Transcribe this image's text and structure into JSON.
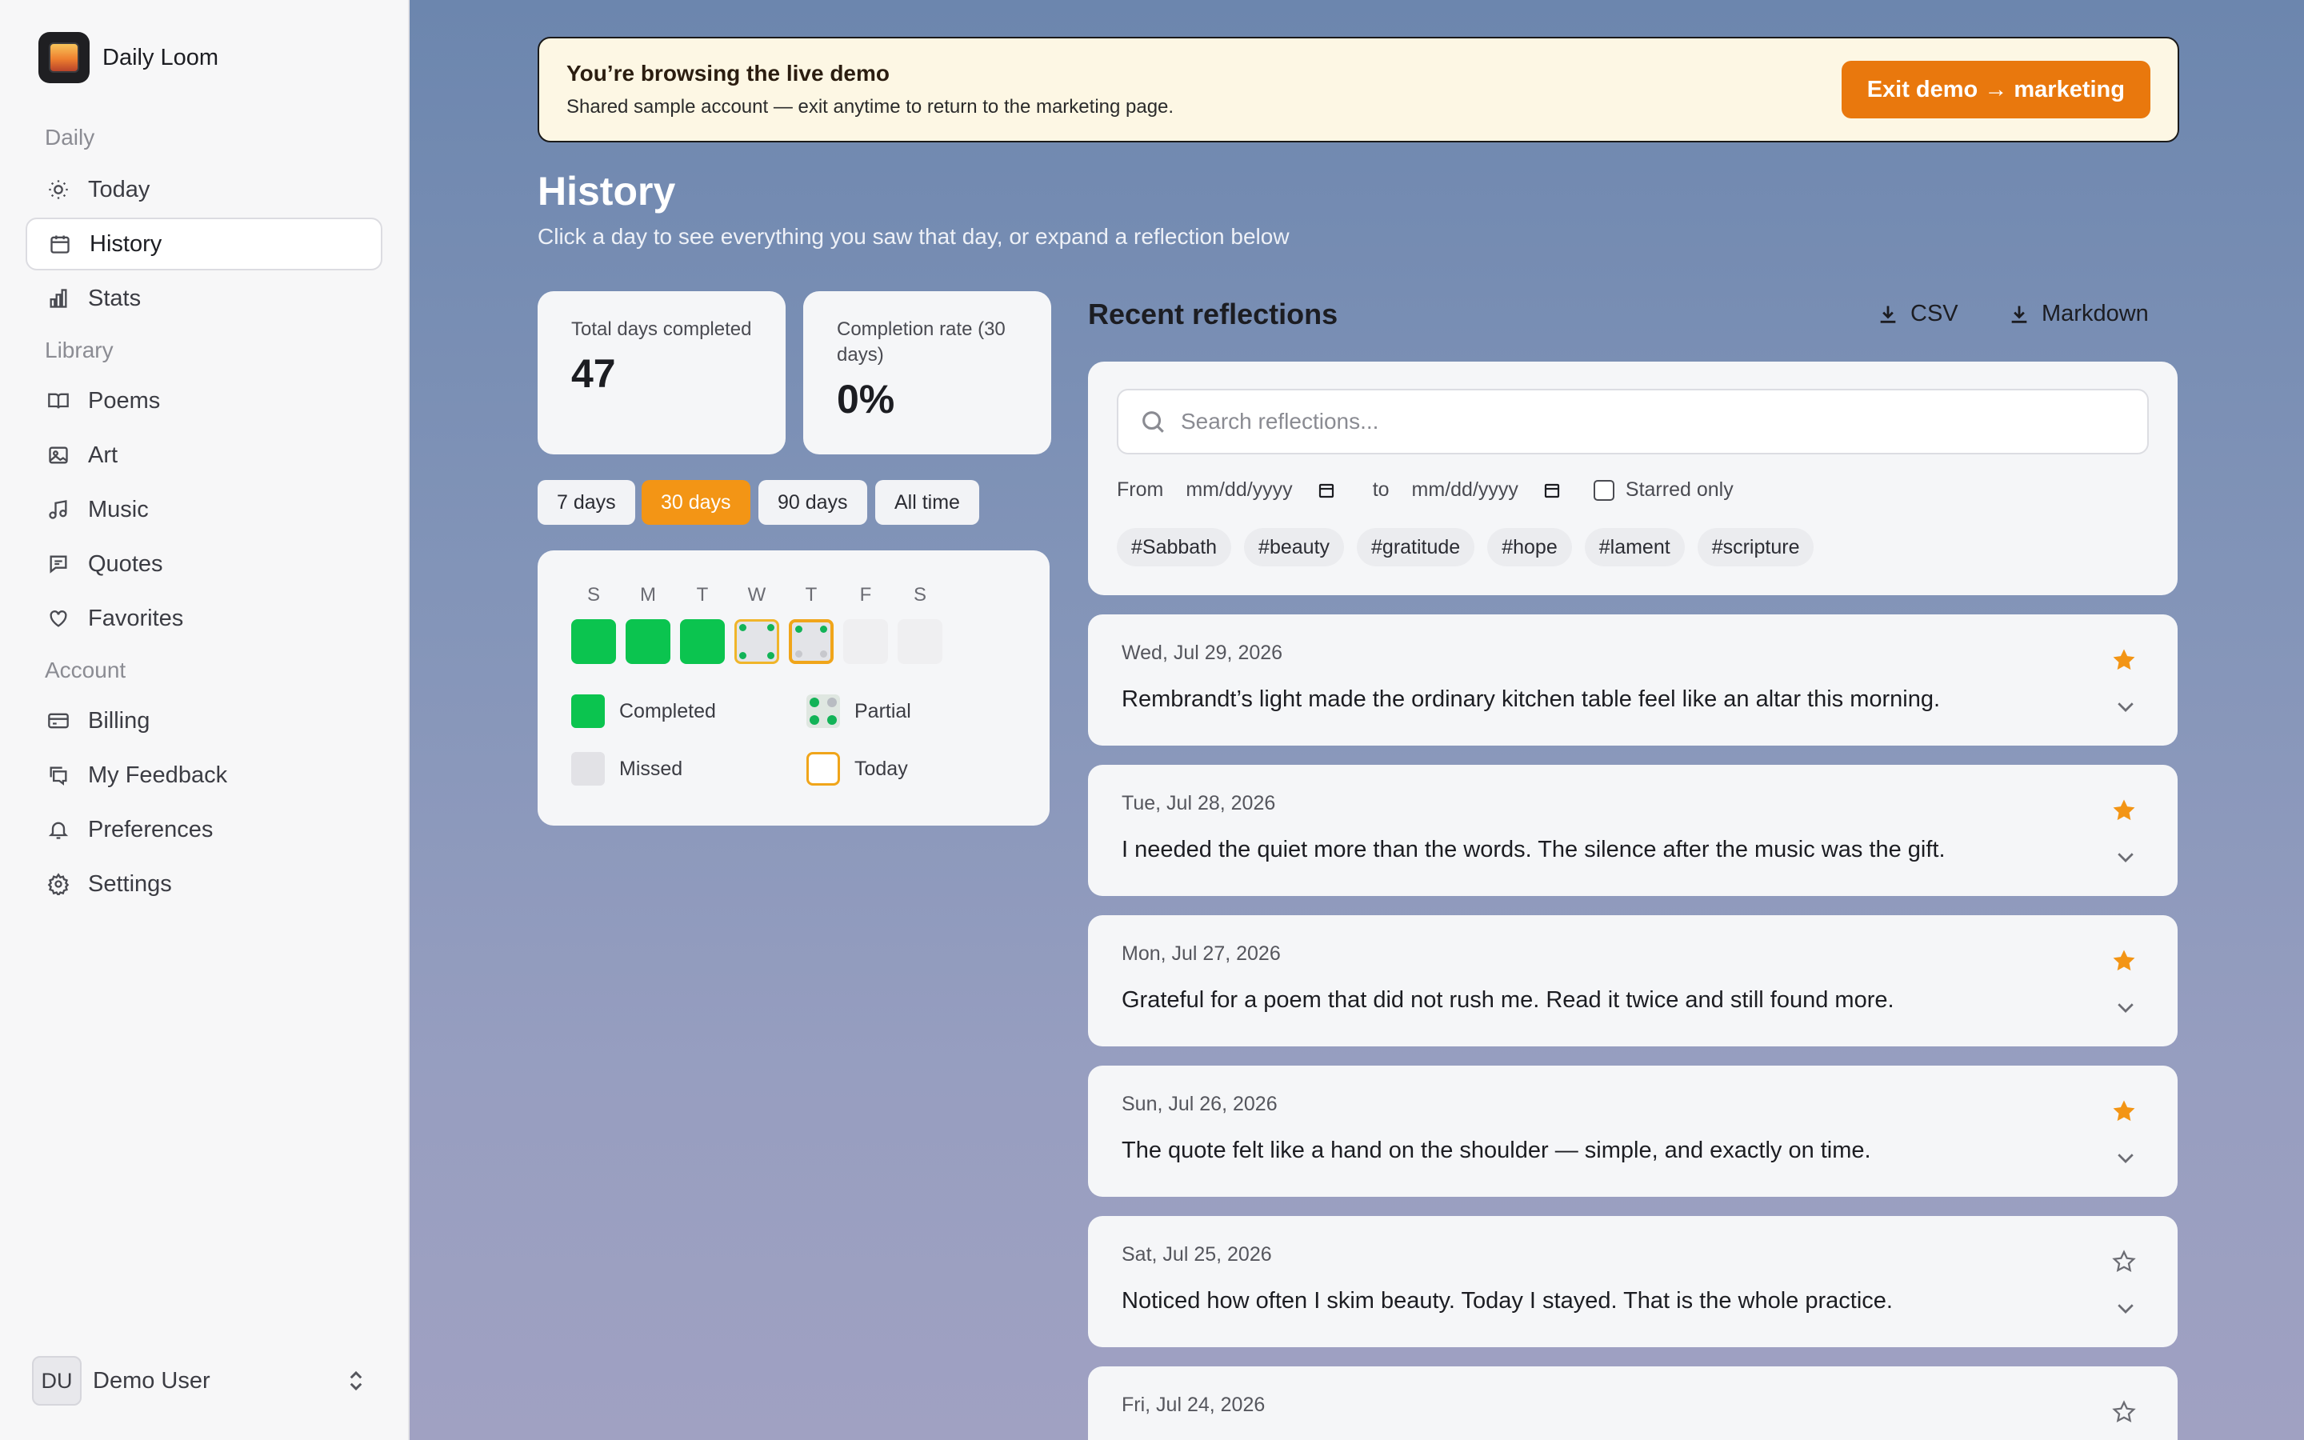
{
  "app": {
    "name": "Daily Loom"
  },
  "sidebar": {
    "sections": [
      {
        "label": "Daily",
        "items": [
          {
            "label": "Today",
            "icon": "sun-icon"
          },
          {
            "label": "History",
            "icon": "calendar-icon",
            "active": true
          },
          {
            "label": "Stats",
            "icon": "bar-chart-icon"
          }
        ]
      },
      {
        "label": "Library",
        "items": [
          {
            "label": "Poems",
            "icon": "book-icon"
          },
          {
            "label": "Art",
            "icon": "image-icon"
          },
          {
            "label": "Music",
            "icon": "music-icon"
          },
          {
            "label": "Quotes",
            "icon": "quote-icon"
          },
          {
            "label": "Favorites",
            "icon": "heart-icon"
          }
        ]
      },
      {
        "label": "Account",
        "items": [
          {
            "label": "Billing",
            "icon": "credit-card-icon"
          },
          {
            "label": "My Feedback",
            "icon": "feedback-icon"
          },
          {
            "label": "Preferences",
            "icon": "bell-icon"
          },
          {
            "label": "Settings",
            "icon": "gear-icon"
          }
        ]
      }
    ],
    "user": {
      "initials": "DU",
      "name": "Demo User"
    }
  },
  "banner": {
    "title": "You’re browsing the live demo",
    "subtitle": "Shared sample account — exit anytime to return to the marketing page.",
    "button": "Exit demo → marketing"
  },
  "page": {
    "title": "History",
    "subtitle": "Click a day to see everything you saw that day, or expand a reflection below"
  },
  "stats": {
    "total": {
      "label": "Total days completed",
      "value": "47"
    },
    "rate": {
      "label": "Completion rate (30 days)",
      "value": "0%"
    }
  },
  "ranges": {
    "items": [
      "7 days",
      "30 days",
      "90 days",
      "All time"
    ],
    "active": "30 days"
  },
  "calendar": {
    "weekdays": [
      "S",
      "M",
      "T",
      "W",
      "T",
      "F",
      "S"
    ],
    "days": [
      "completed",
      "completed",
      "completed",
      "partial",
      "partial-today",
      "missed",
      "missed"
    ],
    "legend": {
      "completed": "Completed",
      "partial": "Partial",
      "missed": "Missed",
      "today": "Today"
    },
    "colors": {
      "completed": "#0bc44f",
      "today": "#f0a51a",
      "accent": "#f39515"
    }
  },
  "reflections": {
    "title": "Recent reflections",
    "export_csv": "CSV",
    "export_md": "Markdown",
    "search_placeholder": "Search reflections...",
    "from_label": "From",
    "to_label": "to",
    "date_placeholder": "mm/dd/yyyy",
    "starred_label": "Starred only",
    "tags": [
      "#Sabbath",
      "#beauty",
      "#gratitude",
      "#hope",
      "#lament",
      "#scripture"
    ],
    "items": [
      {
        "date": "Wed, Jul 29, 2026",
        "text": "Rembrandt’s light made the ordinary kitchen table feel like an altar this morning.",
        "starred": true
      },
      {
        "date": "Tue, Jul 28, 2026",
        "text": "I needed the quiet more than the words. The silence after the music was the gift.",
        "starred": true
      },
      {
        "date": "Mon, Jul 27, 2026",
        "text": "Grateful for a poem that did not rush me. Read it twice and still found more.",
        "starred": true
      },
      {
        "date": "Sun, Jul 26, 2026",
        "text": "The quote felt like a hand on the shoulder — simple, and exactly on time.",
        "starred": true
      },
      {
        "date": "Sat, Jul 25, 2026",
        "text": "Noticed how often I skim beauty. Today I stayed. That is the whole practice.",
        "starred": false
      },
      {
        "date": "Fri, Jul 24, 2026",
        "text": "",
        "starred": false
      }
    ]
  }
}
